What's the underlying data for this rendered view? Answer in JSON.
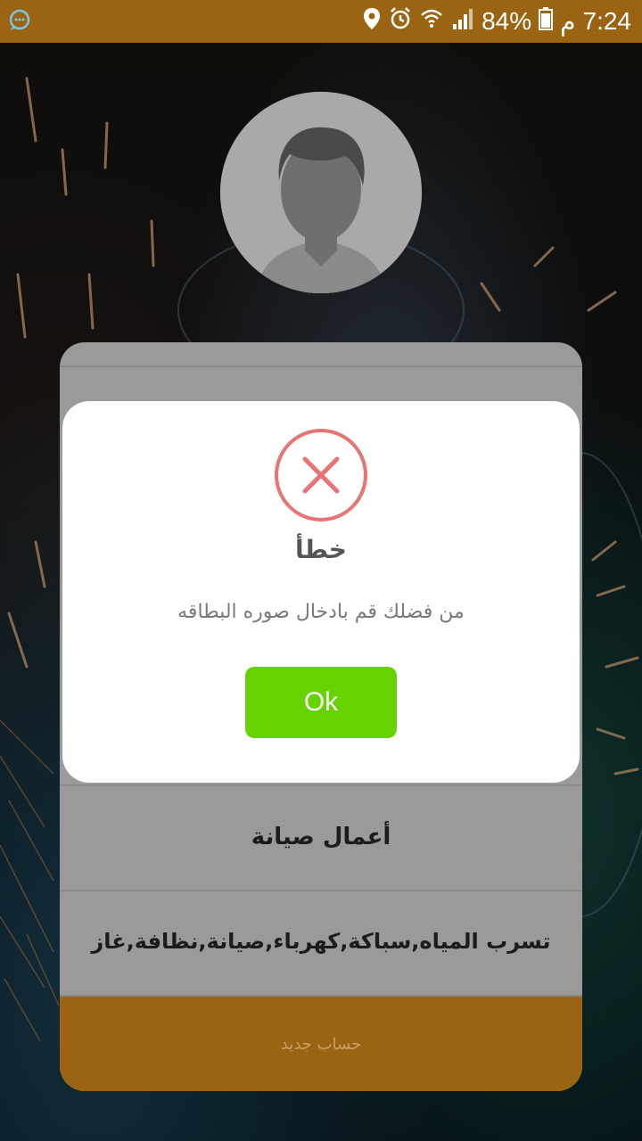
{
  "status_bar": {
    "time": "7:24",
    "am_pm": "م",
    "battery_percent": "84%",
    "icons": [
      "chat-bubble-icon",
      "location-pin-icon",
      "alarm-icon",
      "wifi-icon",
      "signal-icon",
      "battery-icon"
    ]
  },
  "profile": {
    "avatar_icon": "default-avatar-icon"
  },
  "card": {
    "row_3": "أعمال صيانة",
    "row_4": "تسرب المياه,سباكة,كهرباء,صيانة,نظافة,غاز",
    "footer_button": "حساب جديد"
  },
  "dialog": {
    "icon": "error-x-icon",
    "title": "خطأ",
    "message": "من فضلك قم بادخال صوره البطاقه",
    "ok_label": "Ok",
    "colors": {
      "error_red": "#e97375",
      "ok_green": "#66d300"
    }
  },
  "colors": {
    "accent_brown": "#9a6412",
    "card_gray": "#9a9a9a"
  }
}
